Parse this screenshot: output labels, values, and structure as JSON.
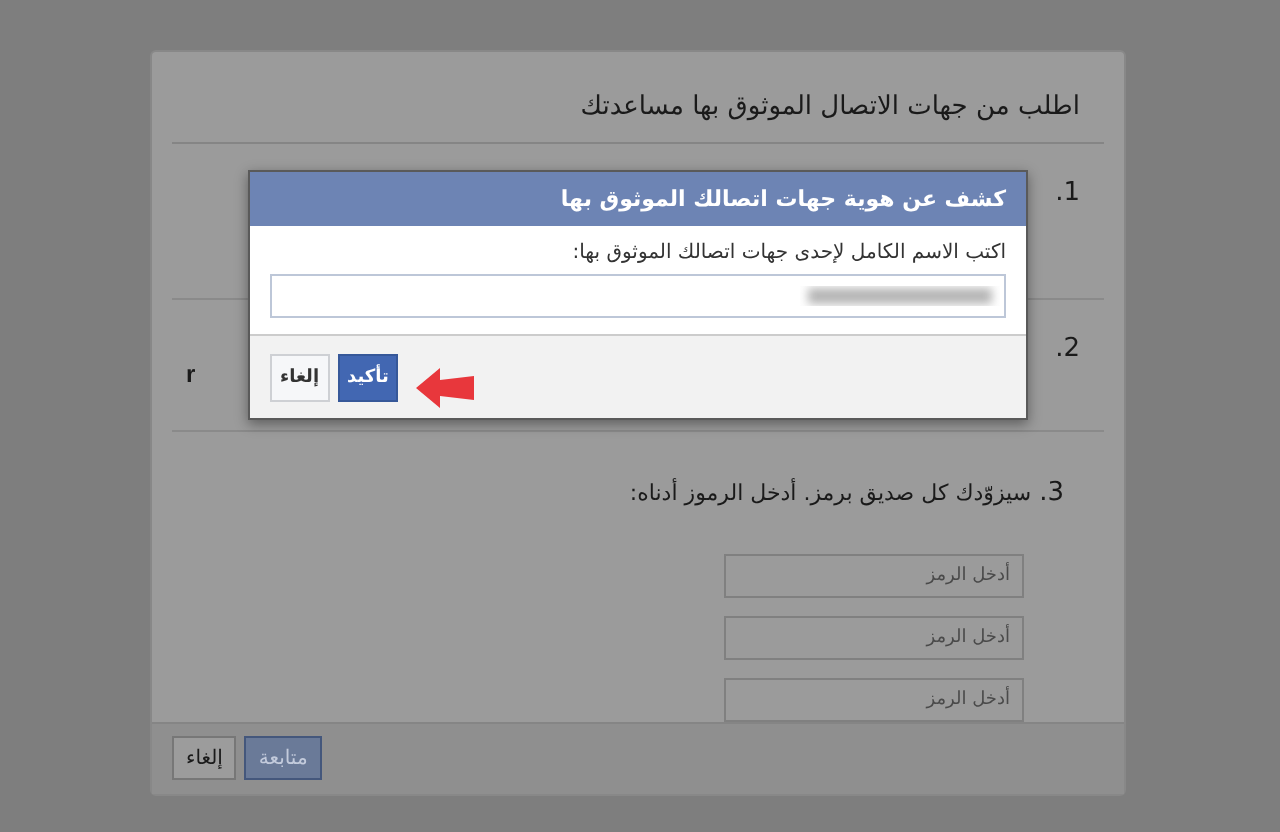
{
  "page": {
    "heading": "اطلب من جهات الاتصال الموثوق بها مساعدتك",
    "steps": [
      {
        "number": "1.",
        "kind": "hidden"
      },
      {
        "number": "2.",
        "text": "r",
        "kind": "hidden"
      },
      {
        "number": "3.",
        "text": "سيزوّدك كل صديق برمز. أدخل الرموز أدناه:",
        "kind": "codes",
        "fields": [
          {
            "placeholder": "أدخل الرمز"
          },
          {
            "placeholder": "أدخل الرمز"
          },
          {
            "placeholder": "أدخل الرمز"
          }
        ]
      }
    ],
    "buttons": [
      {
        "label": "متابعة",
        "kind": "primary",
        "disabled": true
      },
      {
        "label": "إلغاء",
        "kind": "secondary"
      }
    ]
  },
  "dialog": {
    "title": "كشف عن هوية جهات اتصالك الموثوق بها",
    "field_label": "اكتب الاسم الكامل لإحدى جهات اتصالك الموثوق بها:",
    "buttons": [
      {
        "label": "تأكيد",
        "kind": "primary"
      },
      {
        "label": "إلغاء",
        "kind": "secondary"
      }
    ]
  }
}
